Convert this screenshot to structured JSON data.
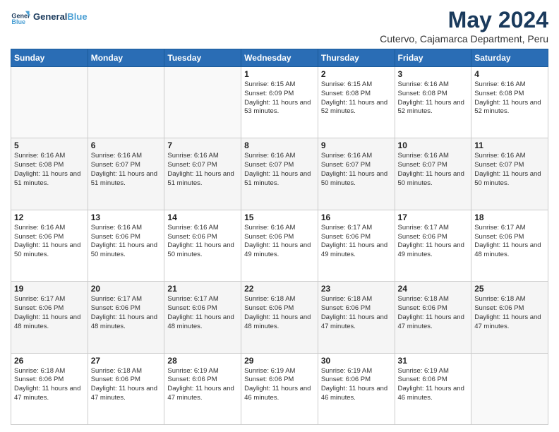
{
  "header": {
    "logo_general": "General",
    "logo_blue": "Blue",
    "title": "May 2024",
    "subtitle": "Cutervo, Cajamarca Department, Peru"
  },
  "calendar": {
    "days_of_week": [
      "Sunday",
      "Monday",
      "Tuesday",
      "Wednesday",
      "Thursday",
      "Friday",
      "Saturday"
    ],
    "weeks": [
      [
        {
          "day": "",
          "info": ""
        },
        {
          "day": "",
          "info": ""
        },
        {
          "day": "",
          "info": ""
        },
        {
          "day": "1",
          "info": "Sunrise: 6:15 AM\nSunset: 6:09 PM\nDaylight: 11 hours and 53 minutes."
        },
        {
          "day": "2",
          "info": "Sunrise: 6:15 AM\nSunset: 6:08 PM\nDaylight: 11 hours and 52 minutes."
        },
        {
          "day": "3",
          "info": "Sunrise: 6:16 AM\nSunset: 6:08 PM\nDaylight: 11 hours and 52 minutes."
        },
        {
          "day": "4",
          "info": "Sunrise: 6:16 AM\nSunset: 6:08 PM\nDaylight: 11 hours and 52 minutes."
        }
      ],
      [
        {
          "day": "5",
          "info": "Sunrise: 6:16 AM\nSunset: 6:08 PM\nDaylight: 11 hours and 51 minutes."
        },
        {
          "day": "6",
          "info": "Sunrise: 6:16 AM\nSunset: 6:07 PM\nDaylight: 11 hours and 51 minutes."
        },
        {
          "day": "7",
          "info": "Sunrise: 6:16 AM\nSunset: 6:07 PM\nDaylight: 11 hours and 51 minutes."
        },
        {
          "day": "8",
          "info": "Sunrise: 6:16 AM\nSunset: 6:07 PM\nDaylight: 11 hours and 51 minutes."
        },
        {
          "day": "9",
          "info": "Sunrise: 6:16 AM\nSunset: 6:07 PM\nDaylight: 11 hours and 50 minutes."
        },
        {
          "day": "10",
          "info": "Sunrise: 6:16 AM\nSunset: 6:07 PM\nDaylight: 11 hours and 50 minutes."
        },
        {
          "day": "11",
          "info": "Sunrise: 6:16 AM\nSunset: 6:07 PM\nDaylight: 11 hours and 50 minutes."
        }
      ],
      [
        {
          "day": "12",
          "info": "Sunrise: 6:16 AM\nSunset: 6:06 PM\nDaylight: 11 hours and 50 minutes."
        },
        {
          "day": "13",
          "info": "Sunrise: 6:16 AM\nSunset: 6:06 PM\nDaylight: 11 hours and 50 minutes."
        },
        {
          "day": "14",
          "info": "Sunrise: 6:16 AM\nSunset: 6:06 PM\nDaylight: 11 hours and 50 minutes."
        },
        {
          "day": "15",
          "info": "Sunrise: 6:16 AM\nSunset: 6:06 PM\nDaylight: 11 hours and 49 minutes."
        },
        {
          "day": "16",
          "info": "Sunrise: 6:17 AM\nSunset: 6:06 PM\nDaylight: 11 hours and 49 minutes."
        },
        {
          "day": "17",
          "info": "Sunrise: 6:17 AM\nSunset: 6:06 PM\nDaylight: 11 hours and 49 minutes."
        },
        {
          "day": "18",
          "info": "Sunrise: 6:17 AM\nSunset: 6:06 PM\nDaylight: 11 hours and 48 minutes."
        }
      ],
      [
        {
          "day": "19",
          "info": "Sunrise: 6:17 AM\nSunset: 6:06 PM\nDaylight: 11 hours and 48 minutes."
        },
        {
          "day": "20",
          "info": "Sunrise: 6:17 AM\nSunset: 6:06 PM\nDaylight: 11 hours and 48 minutes."
        },
        {
          "day": "21",
          "info": "Sunrise: 6:17 AM\nSunset: 6:06 PM\nDaylight: 11 hours and 48 minutes."
        },
        {
          "day": "22",
          "info": "Sunrise: 6:18 AM\nSunset: 6:06 PM\nDaylight: 11 hours and 48 minutes."
        },
        {
          "day": "23",
          "info": "Sunrise: 6:18 AM\nSunset: 6:06 PM\nDaylight: 11 hours and 47 minutes."
        },
        {
          "day": "24",
          "info": "Sunrise: 6:18 AM\nSunset: 6:06 PM\nDaylight: 11 hours and 47 minutes."
        },
        {
          "day": "25",
          "info": "Sunrise: 6:18 AM\nSunset: 6:06 PM\nDaylight: 11 hours and 47 minutes."
        }
      ],
      [
        {
          "day": "26",
          "info": "Sunrise: 6:18 AM\nSunset: 6:06 PM\nDaylight: 11 hours and 47 minutes."
        },
        {
          "day": "27",
          "info": "Sunrise: 6:18 AM\nSunset: 6:06 PM\nDaylight: 11 hours and 47 minutes."
        },
        {
          "day": "28",
          "info": "Sunrise: 6:19 AM\nSunset: 6:06 PM\nDaylight: 11 hours and 47 minutes."
        },
        {
          "day": "29",
          "info": "Sunrise: 6:19 AM\nSunset: 6:06 PM\nDaylight: 11 hours and 46 minutes."
        },
        {
          "day": "30",
          "info": "Sunrise: 6:19 AM\nSunset: 6:06 PM\nDaylight: 11 hours and 46 minutes."
        },
        {
          "day": "31",
          "info": "Sunrise: 6:19 AM\nSunset: 6:06 PM\nDaylight: 11 hours and 46 minutes."
        },
        {
          "day": "",
          "info": ""
        }
      ]
    ]
  }
}
